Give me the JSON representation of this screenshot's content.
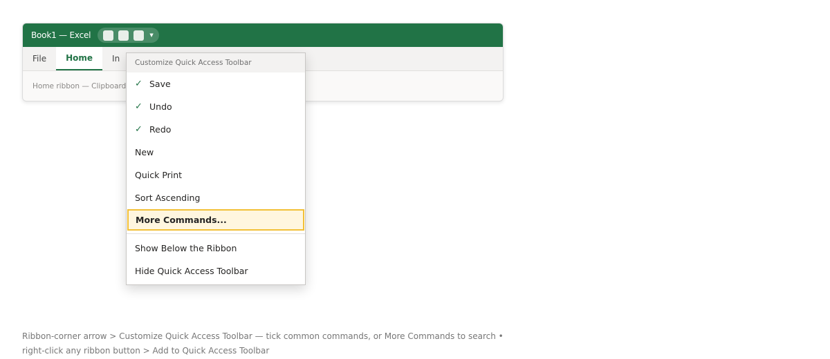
{
  "window": {
    "title": "Book1 — Excel"
  },
  "tabs": [
    {
      "label": "File"
    },
    {
      "label": "Home"
    },
    {
      "label": "In"
    }
  ],
  "ribbon": {
    "text": "Home ribbon — Clipboard •"
  },
  "menu": {
    "header": "Customize Quick Access Toolbar",
    "check_glyph": "✓",
    "items": [
      {
        "label": "Save",
        "checked": true
      },
      {
        "label": "Undo",
        "checked": true
      },
      {
        "label": "Redo",
        "checked": true
      },
      {
        "label": "New",
        "checked": false
      },
      {
        "label": "Quick Print",
        "checked": false
      },
      {
        "label": "Sort Ascending",
        "checked": false
      },
      {
        "label": "More Commands...",
        "highlighted": true
      },
      {
        "label": "Show Below the Ribbon"
      },
      {
        "label": "Hide Quick Access Toolbar"
      }
    ]
  },
  "footer": {
    "line1": "Ribbon-corner arrow > Customize Quick Access Toolbar — tick common commands, or More Commands to search •",
    "line2": "right-click any ribbon button > Add to Quick Access Toolbar"
  },
  "colors": {
    "accent": "#217346",
    "highlight_border": "#f2c037",
    "highlight_fill": "#fff6df"
  }
}
